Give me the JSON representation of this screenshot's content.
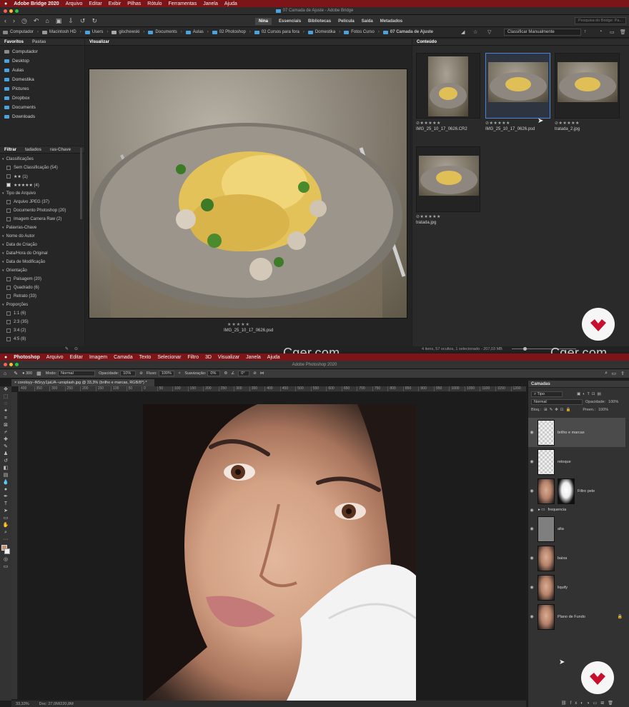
{
  "bridge": {
    "menu": [
      "Adobe Bridge 2020",
      "Arquivo",
      "Editar",
      "Exibir",
      "Pilhas",
      "Rótulo",
      "Ferramentas",
      "Janela",
      "Ajuda"
    ],
    "window_title": "07 Camada de Ajuste - Adobe Bridge",
    "workspaces": [
      "Nina",
      "Essenciais",
      "Bibliotecas",
      "Película",
      "Saída",
      "Metadados"
    ],
    "search_placeholder": "Pesquisa do Bridge: Pa...",
    "sort_label": "Classificar Manualmente",
    "breadcrumbs": [
      "Computador",
      "Macintosh HD",
      "Users",
      "gischewski",
      "Documents",
      "Aulas",
      "02 Photoshop",
      "02 Cursos para fora",
      "Domestika",
      "Fotos Curso",
      "07 Camada de Ajuste"
    ],
    "left_tabs": [
      "Favoritos",
      "Pastas"
    ],
    "favorites": [
      "Computador",
      "Desktop",
      "Aulas",
      "Domestika",
      "Pictures",
      "Dropbox",
      "Documents",
      "Downloads"
    ],
    "filter_tabs": [
      "Filtrar",
      "tadados",
      "ras-Chave"
    ],
    "filters": [
      {
        "label": "Classificações",
        "type": "cat"
      },
      {
        "label": "Sem Classificação (54)",
        "type": "item"
      },
      {
        "label": "★★ (1)",
        "type": "item"
      },
      {
        "label": "★★★★★ (4)",
        "type": "item",
        "checked": true
      },
      {
        "label": "Tipo de Arquivo",
        "type": "cat"
      },
      {
        "label": "Arquivo JPEG (37)",
        "type": "item"
      },
      {
        "label": "Documento Photoshop (20)",
        "type": "item"
      },
      {
        "label": "Imagem Camera Raw (2)",
        "type": "item"
      },
      {
        "label": "Palavras-Chave",
        "type": "cat"
      },
      {
        "label": "Nome do Autor",
        "type": "cat"
      },
      {
        "label": "Data de Criação",
        "type": "cat"
      },
      {
        "label": "Data/Hora do Original",
        "type": "cat"
      },
      {
        "label": "Data de Modificação",
        "type": "cat"
      },
      {
        "label": "Orientação",
        "type": "cat"
      },
      {
        "label": "Paisagem (20)",
        "type": "item"
      },
      {
        "label": "Quadrado (6)",
        "type": "item"
      },
      {
        "label": "Retrato (33)",
        "type": "item"
      },
      {
        "label": "Proporções",
        "type": "cat"
      },
      {
        "label": "1:1 (6)",
        "type": "item"
      },
      {
        "label": "2:3 (35)",
        "type": "item"
      },
      {
        "label": "3:4 (2)",
        "type": "item"
      },
      {
        "label": "4:5 (8)",
        "type": "item"
      }
    ],
    "preview_tab": "Visualizar",
    "preview_stars": "★★★★★",
    "preview_caption": "IMG_25_10_17_0626.psd",
    "content_tab": "Conteúdo",
    "thumbnails": [
      {
        "name": "IMG_25_10_17_0626.CR2",
        "stars": "⊘★★★★★"
      },
      {
        "name": "IMG_25_10_17_0626.psd",
        "stars": "⊘★★★★★"
      },
      {
        "name": "tratada_2.jpg",
        "stars": "⊘★★★★★"
      },
      {
        "name": "tratada.jpg",
        "stars": "⊘★★★★★"
      }
    ],
    "status": "4 itens, 57 ocultos, 1 selecionado - 207,03 MB"
  },
  "photoshop": {
    "menu": [
      "Photoshop",
      "Arquivo",
      "Editar",
      "Imagem",
      "Camada",
      "Texto",
      "Selecionar",
      "Filtro",
      "3D",
      "Visualizar",
      "Janela",
      "Ajuda"
    ],
    "window_title": "Adobe Photoshop 2020",
    "options": {
      "mode_label": "Modo:",
      "mode_value": "Normal",
      "opacity_label": "Opacidade:",
      "opacity_value": "10%",
      "flow_label": "Fluxo:",
      "flow_value": "100%",
      "smoothing_label": "Suavização:",
      "smoothing_value": "0%",
      "angle_value": "0°",
      "brush_size": "300"
    },
    "doc_tab": "coroloyy--fk5ryy1jaUA--unsplash.jpg @ 33,3% (brilho e marcas, RGB/8*) *",
    "ruler": [
      "400",
      "350",
      "300",
      "250",
      "200",
      "150",
      "100",
      "50",
      "0",
      "50",
      "100",
      "150",
      "200",
      "250",
      "300",
      "350",
      "400",
      "450",
      "500",
      "550",
      "600",
      "650",
      "700",
      "750",
      "800",
      "850",
      "900",
      "950",
      "1000",
      "1050",
      "1100",
      "1150",
      "1200"
    ],
    "status": {
      "zoom": "33,33%",
      "doc": "Doc: 27,0M/220,8M"
    },
    "layers_title": "Camadas",
    "kind_label": "Tipo",
    "blend_mode": "Normal",
    "opacity_label": "Opacidade:",
    "opacity_value": "100%",
    "lock_label": "Bloq.:",
    "fill_label": "Preen.:",
    "fill_value": "100%",
    "layers": [
      {
        "name": "brilho e marcas",
        "thumb": "checker",
        "selected": true
      },
      {
        "name": "retoque",
        "thumb": "checker"
      },
      {
        "name": "Filtro pele",
        "thumb": "face",
        "mask": true
      },
      {
        "name": "frequencia",
        "thumb": "group"
      },
      {
        "name": "alta",
        "thumb": "gray"
      },
      {
        "name": "baixa",
        "thumb": "face"
      },
      {
        "name": "liquify",
        "thumb": "face"
      },
      {
        "name": "Plano de Fundo",
        "thumb": "face",
        "locked": true
      }
    ]
  },
  "watermark": "Cger.com",
  "colors": {
    "menubar": "#7d1518",
    "accent": "#4aa3de",
    "badge_red": "#c8102e"
  }
}
